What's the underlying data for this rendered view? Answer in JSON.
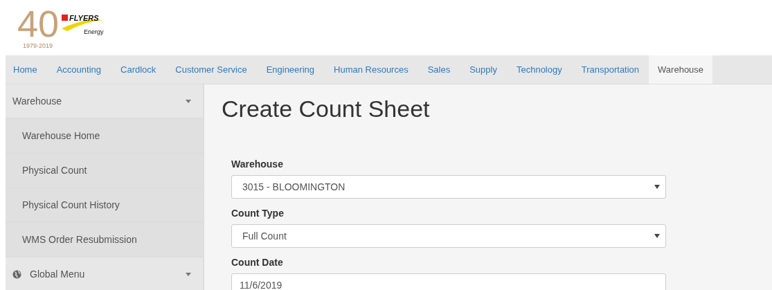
{
  "logo": {
    "number": "40",
    "brand": "FLYERS",
    "tagline": "Energy",
    "years": "1979-2019"
  },
  "nav_tabs": [
    {
      "label": "Home",
      "selected": false
    },
    {
      "label": "Accounting",
      "selected": false
    },
    {
      "label": "Cardlock",
      "selected": false
    },
    {
      "label": "Customer Service",
      "selected": false
    },
    {
      "label": "Engineering",
      "selected": false
    },
    {
      "label": "Human Resources",
      "selected": false
    },
    {
      "label": "Sales",
      "selected": false
    },
    {
      "label": "Supply",
      "selected": false
    },
    {
      "label": "Technology",
      "selected": false
    },
    {
      "label": "Transportation",
      "selected": false
    },
    {
      "label": "Warehouse",
      "selected": true
    }
  ],
  "sidebar": {
    "sections": [
      {
        "kind": "menu",
        "label": "Warehouse",
        "items": [
          "Warehouse Home",
          "Physical Count",
          "Physical Count History",
          "WMS Order Resubmission"
        ]
      },
      {
        "kind": "globe",
        "label": "Global Menu"
      }
    ]
  },
  "page_title": "Create Count Sheet",
  "form": [
    {
      "kind": "select",
      "label": "Warehouse",
      "value": "3015 - BLOOMINGTON"
    },
    {
      "kind": "select",
      "label": "Count Type",
      "value": "Full Count"
    },
    {
      "kind": "input",
      "label": "Count Date",
      "value": "11/6/2019"
    }
  ]
}
